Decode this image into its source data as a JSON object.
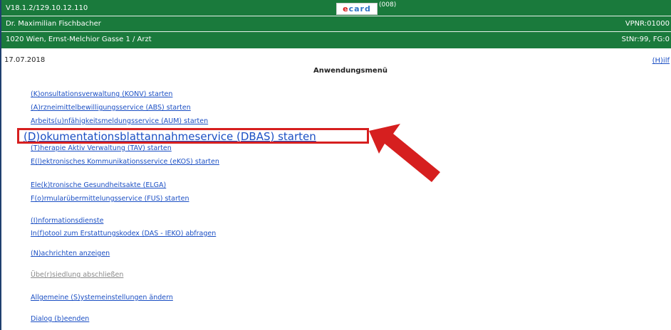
{
  "header": {
    "version": "V18.1.2/129.10.12.110",
    "doctor": "Dr. Maximilian Fischbacher",
    "address": "1020 Wien, Ernst-Melchior Gasse 1 / Arzt",
    "logo_e": "e",
    "logo_card": "card",
    "logo_code": "(008)",
    "vpnr": "VPNR:01000",
    "stnr": "StNr:99, FG:0",
    "colors": {
      "bar": "#1a7a3c",
      "link": "#1b4fc4",
      "highlight": "#d61f1f"
    }
  },
  "subbar": {
    "date": "17.07.2018",
    "help": "(H)ilf",
    "title": "Anwendungsmenü"
  },
  "menu": {
    "items": [
      {
        "label": "(K)onsultationsverwaltung (KONV) starten"
      },
      {
        "label": "(A)rzneimittelbewilligungsservice (ABS) starten"
      },
      {
        "label": "Arbeits(u)nfähigkeitsmeldungsservice (AUM) starten"
      },
      {
        "label": "(D)okumentationsblattannahmeservice (DBAS) starten"
      },
      {
        "label": "(T)herapie Aktiv Verwaltung (TAV) starten"
      },
      {
        "label": "E(l)ektronisches Kommunikationsservice (eKOS) starten"
      },
      {
        "label": "Ele(k)tronische Gesundheitsakte (ELGA)"
      },
      {
        "label": "F(o)rmularübermittelungsservice (FUS) starten"
      },
      {
        "label": "(I)nformationsdienste"
      },
      {
        "label": "In(f)otool zum Erstattungskodex (DAS - IEKO) abfragen"
      },
      {
        "label": "(N)achrichten anzeigen"
      },
      {
        "label": "Übe(r)siedlung abschließen"
      },
      {
        "label": "Allgemeine (S)ystemeinstellungen ändern"
      },
      {
        "label": "Dialog (b)eenden"
      }
    ]
  }
}
